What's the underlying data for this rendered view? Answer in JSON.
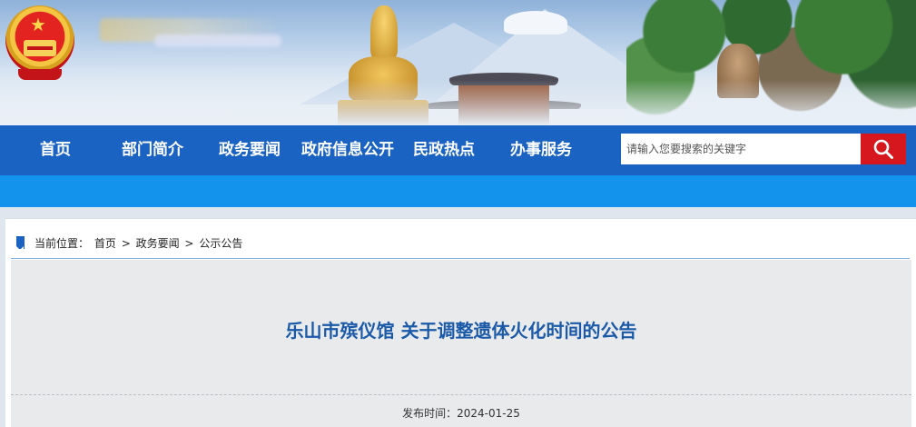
{
  "header": {
    "emblem_icon": "national-emblem-icon"
  },
  "nav": {
    "items": [
      {
        "label": "首页"
      },
      {
        "label": "部门简介"
      },
      {
        "label": "政务要闻"
      },
      {
        "label": "政府信息公开"
      },
      {
        "label": "民政热点"
      },
      {
        "label": "办事服务"
      }
    ],
    "search_placeholder": "请输入您要搜索的关键字",
    "search_icon": "search-icon"
  },
  "breadcrumb": {
    "prefix": "当前位置：",
    "items": [
      "首页",
      "政务要闻",
      "公示公告"
    ],
    "separator": ">"
  },
  "article": {
    "title": "乐山市殡仪馆 关于调整遗体火化时间的公告",
    "publish_label": "发布时间：",
    "publish_date": "2024-01-25"
  },
  "colors": {
    "nav_bg": "#1a63c3",
    "subbar_bg": "#1493ec",
    "search_button": "#d6181e",
    "title_color": "#1a5aa8"
  }
}
